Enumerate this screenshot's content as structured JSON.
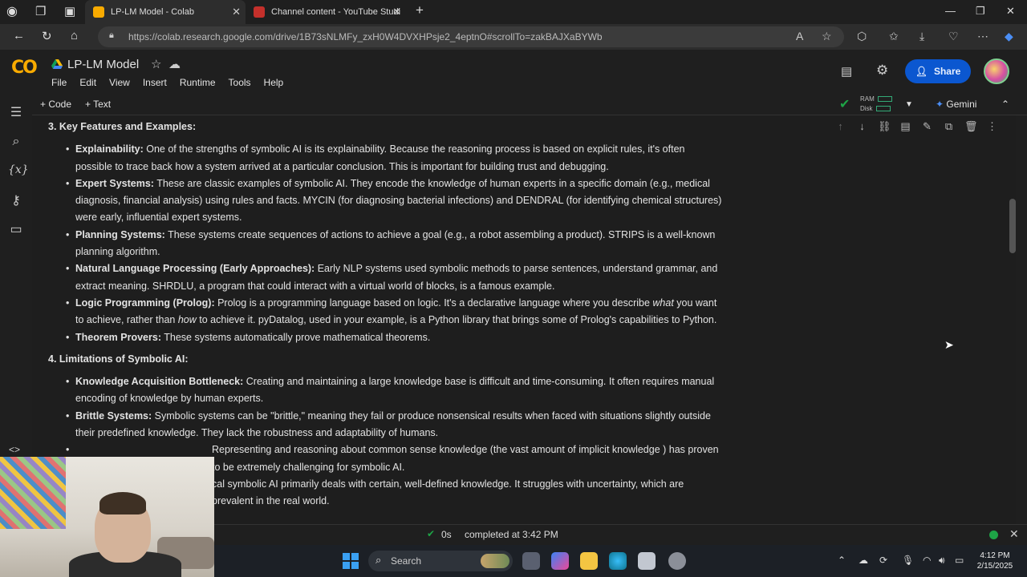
{
  "browser": {
    "tabs": [
      {
        "label": "LP-LM Model - Colab",
        "active": true
      },
      {
        "label": "Channel content - YouTube Studi",
        "active": false
      }
    ],
    "new_tab": "+",
    "url": "https://colab.research.google.com/drive/1B73sNLMFy_zxH0W4DVXHPsje2_4eptnO#scrollTo=zakBAJXaBYWb"
  },
  "colab": {
    "logo": "CO",
    "title": "LP-LM Model",
    "menu": [
      "File",
      "Edit",
      "View",
      "Insert",
      "Runtime",
      "Tools",
      "Help"
    ],
    "share_label": "Share",
    "toolbar": {
      "add_code": "+ Code",
      "add_text": "+ Text",
      "ram": "RAM",
      "disk": "Disk",
      "gemini": "Gemini"
    }
  },
  "content": {
    "section3_title": "3. Key Features and Examples:",
    "section3_items": [
      {
        "term": "Explainability:",
        "text": " One of the strengths of symbolic AI is its explainability. Because the reasoning process is based on explicit rules, it's often possible to trace back how a system arrived at a particular conclusion. This is important for building trust and debugging."
      },
      {
        "term": "Expert Systems:",
        "text": " These are classic examples of symbolic AI. They encode the knowledge of human experts in a specific domain (e.g., medical diagnosis, financial analysis) using rules and facts. MYCIN (for diagnosing bacterial infections) and DENDRAL (for identifying chemical structures) were early, influential expert systems."
      },
      {
        "term": "Planning Systems:",
        "text": " These systems create sequences of actions to achieve a goal (e.g., a robot assembling a product). STRIPS is a well-known planning algorithm."
      },
      {
        "term": "Natural Language Processing (Early Approaches):",
        "text": " Early NLP systems used symbolic methods to parse sentences, understand grammar, and extract meaning. SHRDLU, a program that could interact with a virtual world of blocks, is a famous example."
      },
      {
        "term": "Logic Programming (Prolog):",
        "text_a": " Prolog is a programming language based on logic. It's a declarative language where you describe ",
        "em_a": "what",
        "text_b": " you want to achieve, rather than ",
        "em_b": "how",
        "text_c": " to achieve it. pyDatalog, used in your example, is a Python library that brings some of Prolog's capabilities to Python."
      },
      {
        "term": "Theorem Provers:",
        "text": " These systems automatically prove mathematical theorems."
      }
    ],
    "section4_title": "4. Limitations of Symbolic AI:",
    "section4_items": [
      {
        "term": "Knowledge Acquisition Bottleneck:",
        "text": " Creating and maintaining a large knowledge base is difficult and time-consuming. It often requires manual encoding of knowledge by human experts."
      },
      {
        "term": "Brittle Systems:",
        "text": " Symbolic systems can be \"brittle,\" meaning they fail or produce nonsensical results when faced with situations slightly outside their predefined knowledge. They lack the robustness and adaptability of humans."
      },
      {
        "term": "",
        "text": "Representing and reasoning about common sense knowledge (the vast amount of implicit knowledge ) has proven to be extremely challenging for symbolic AI."
      },
      {
        "term": "",
        "text": "cal symbolic AI primarily deals with certain, well-defined knowledge. It struggles with uncertainty, which are prevalent in the real world."
      }
    ]
  },
  "status": {
    "elapsed": "0s",
    "completed": "completed at 3:42 PM"
  },
  "taskbar": {
    "search_placeholder": "Search",
    "time": "4:12 PM",
    "date": "2/15/2025"
  },
  "colors": {
    "accent": "#0b57d0",
    "success": "#1ea446",
    "logo": "#f9ab00"
  }
}
